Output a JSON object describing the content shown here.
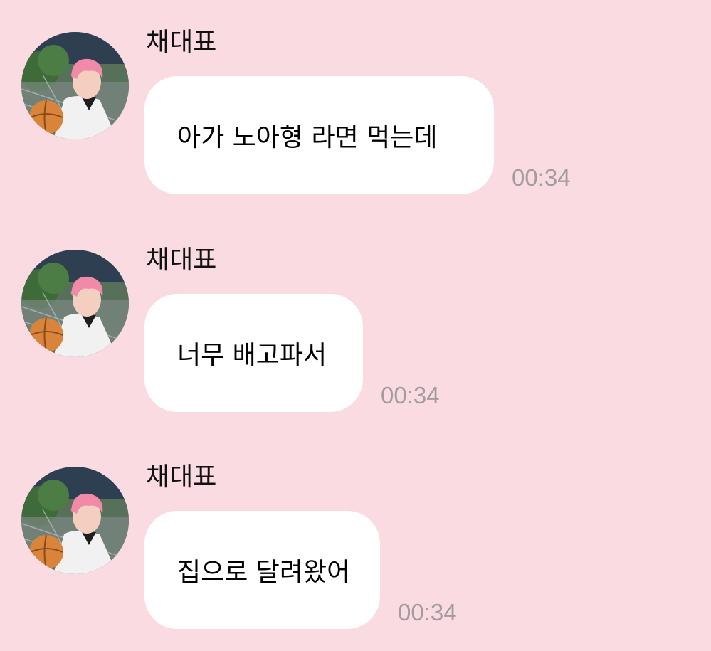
{
  "messages": [
    {
      "sender": "채대표",
      "text": "아가 노아형 라면 먹는데",
      "time": "00:34"
    },
    {
      "sender": "채대표",
      "text": "너무 배고파서",
      "time": "00:34"
    },
    {
      "sender": "채대표",
      "text": "집으로 달려왔어",
      "time": "00:34"
    }
  ],
  "colors": {
    "background": "#f9dbe1",
    "bubble": "#ffffff",
    "time": "#a39b9d"
  },
  "icons": {
    "avatar": "profile-avatar-pink-hair-basketball"
  }
}
